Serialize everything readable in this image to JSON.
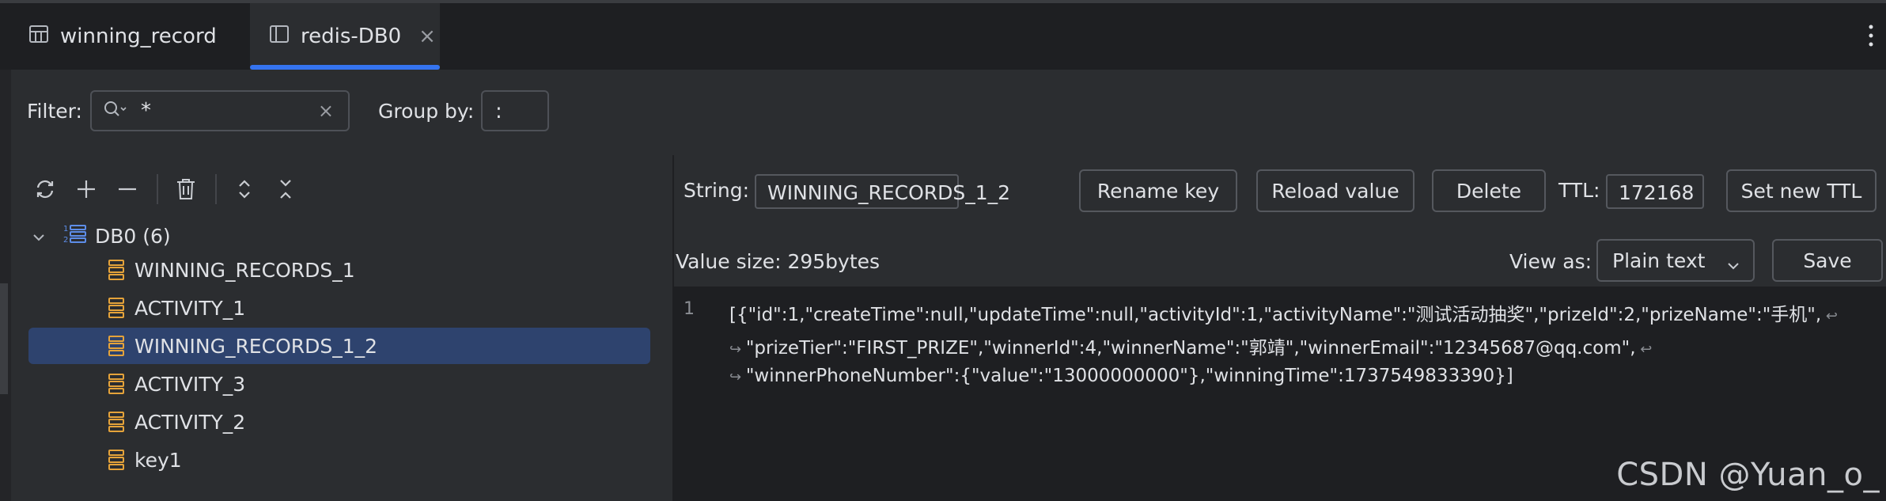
{
  "tabs": [
    {
      "label": "winning_record",
      "icon": "table-icon",
      "active": false
    },
    {
      "label": "redis-DB0",
      "icon": "console-icon",
      "active": true
    }
  ],
  "tab_close": "×",
  "filter": {
    "label": "Filter:",
    "value": "*",
    "clear": "×"
  },
  "groupby": {
    "label": "Group by:",
    "value": ":"
  },
  "tree": {
    "root_label": "DB0 (6)",
    "keys": [
      "WINNING_RECORDS_1",
      "ACTIVITY_1",
      "WINNING_RECORDS_1_2",
      "ACTIVITY_3",
      "ACTIVITY_2",
      "key1"
    ],
    "selected": "WINNING_RECORDS_1_2"
  },
  "detail": {
    "type_label": "String:",
    "key_name": "WINNING_RECORDS_1_2",
    "rename_label": "Rename key",
    "reload_label": "Reload value",
    "delete_label": "Delete",
    "ttl_label": "TTL:",
    "ttl_value": "172168",
    "set_ttl_label": "Set new TTL",
    "value_size": "Value size: 295bytes",
    "view_as_label": "View as:",
    "view_as_value": "Plain text",
    "save_label": "Save",
    "line_number": "1",
    "value_lines": [
      "[{\"id\":1,\"createTime\":null,\"updateTime\":null,\"activityId\":1,\"activityName\":\"测试活动抽奖\",\"prizeId\":2,\"prizeName\":\"手机\",",
      "\"prizeTier\":\"FIRST_PRIZE\",\"winnerId\":4,\"winnerName\":\"郭靖\",\"winnerEmail\":\"12345687@qq.com\",",
      "\"winnerPhoneNumber\":{\"value\":\"13000000000\"},\"winningTime\":1737549833390}]"
    ]
  },
  "watermark": "CSDN @Yuan_o_",
  "colors": {
    "accent": "#3574f0",
    "selection": "#2e436e",
    "key_icon": "#e5a33a",
    "db_icon": "#5d8de8"
  }
}
